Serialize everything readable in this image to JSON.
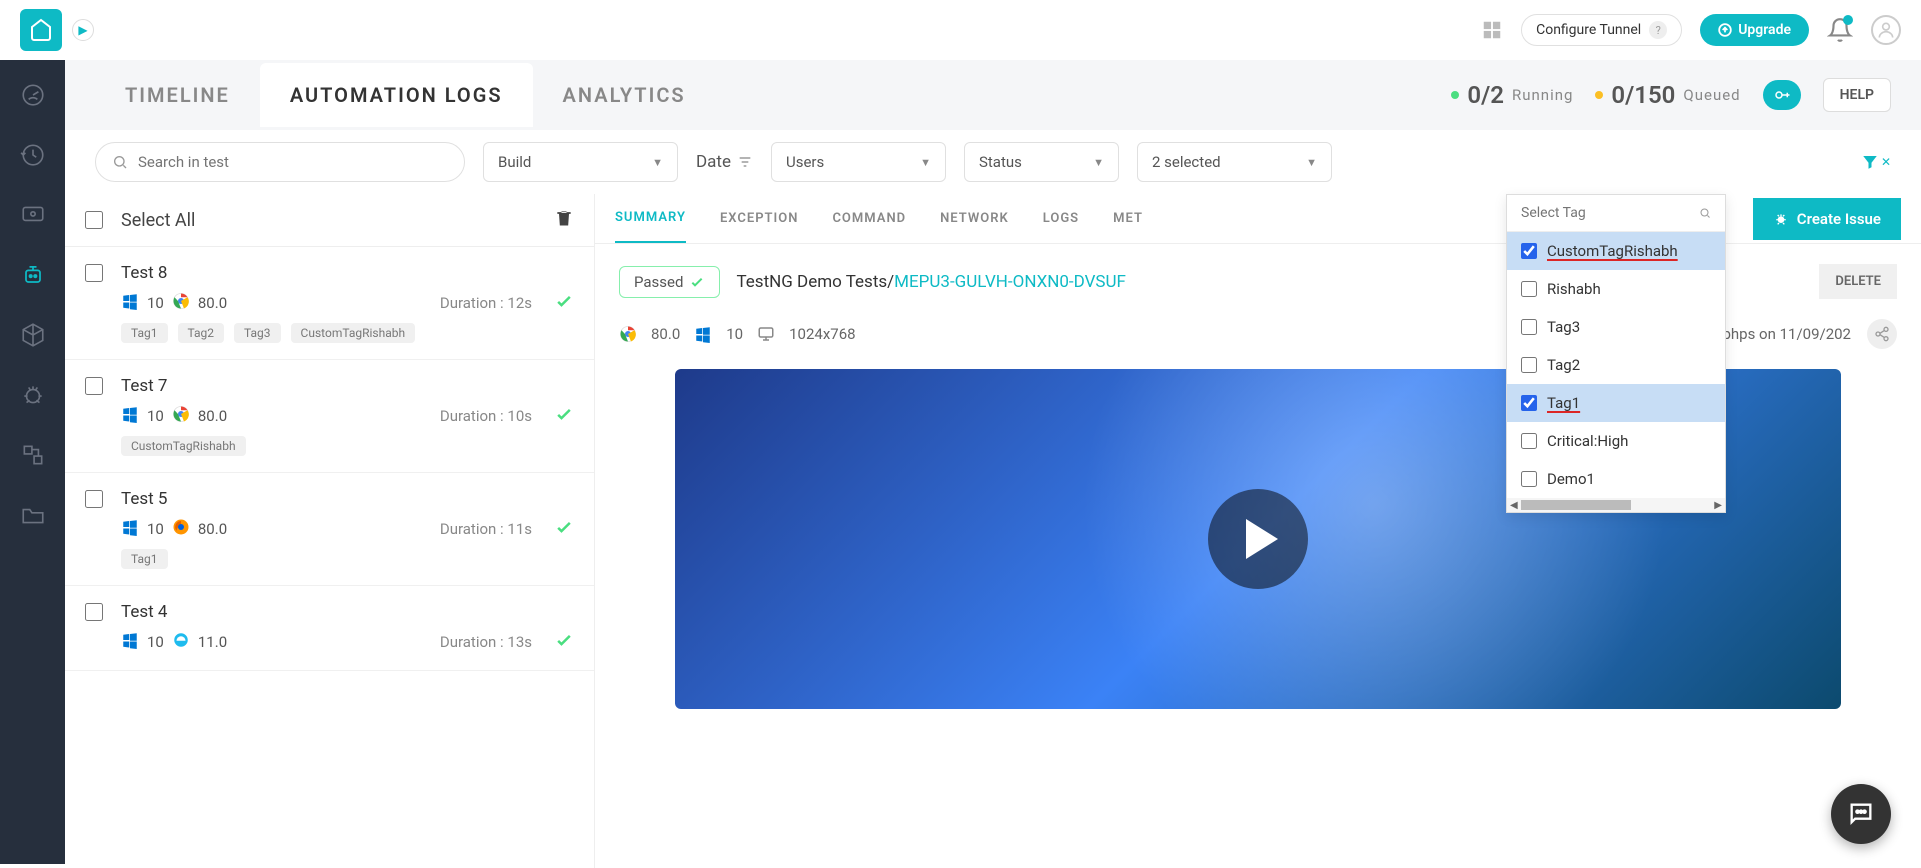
{
  "topbar": {
    "configure_tunnel": "Configure Tunnel",
    "upgrade": "Upgrade"
  },
  "tabs": {
    "timeline": "TIMELINE",
    "automation_logs": "AUTOMATION LOGS",
    "analytics": "ANALYTICS"
  },
  "status": {
    "running_frac": "0/2",
    "running_label": "Running",
    "queued_frac": "0/150",
    "queued_label": "Queued",
    "help": "HELP"
  },
  "filters": {
    "search_placeholder": "Search in test",
    "build": "Build",
    "date": "Date",
    "users": "Users",
    "status": "Status",
    "tags_selected": "2 selected"
  },
  "select_all": "Select All",
  "tests": [
    {
      "name": "Test 8",
      "os": "10",
      "browser": "chrome",
      "ver": "80.0",
      "duration": "Duration : 12s",
      "tags": [
        "Tag1",
        "Tag2",
        "Tag3",
        "CustomTagRishabh"
      ]
    },
    {
      "name": "Test 7",
      "os": "10",
      "browser": "chrome",
      "ver": "80.0",
      "duration": "Duration : 10s",
      "tags": [
        "CustomTagRishabh"
      ]
    },
    {
      "name": "Test 5",
      "os": "10",
      "browser": "firefox",
      "ver": "80.0",
      "duration": "Duration : 11s",
      "tags": [
        "Tag1"
      ]
    },
    {
      "name": "Test 4",
      "os": "10",
      "browser": "ie",
      "ver": "11.0",
      "duration": "Duration : 13s",
      "tags": []
    }
  ],
  "detail_tabs": {
    "summary": "SUMMARY",
    "exception": "EXCEPTION",
    "command": "COMMAND",
    "network": "NETWORK",
    "logs": "LOGS",
    "metadata": "MET"
  },
  "create_issue": "Create Issue",
  "detail": {
    "passed": "Passed",
    "breadcrumb_prefix": "TestNG Demo Tests/",
    "breadcrumb_id": "MEPU3-GULVH-ONXN0-DVSUF",
    "delete": "DELETE",
    "chrome_ver": "80.0",
    "os_ver": "10",
    "resolution": "1024x768",
    "started": "Started by rishabhps on 11/09/202"
  },
  "tag_dropdown": {
    "placeholder": "Select Tag",
    "options": [
      {
        "label": "CustomTagRishabh",
        "checked": true
      },
      {
        "label": "Rishabh",
        "checked": false
      },
      {
        "label": "Tag3",
        "checked": false
      },
      {
        "label": "Tag2",
        "checked": false
      },
      {
        "label": "Tag1",
        "checked": true
      },
      {
        "label": "Critical:High",
        "checked": false
      },
      {
        "label": "Demo1",
        "checked": false
      }
    ]
  }
}
